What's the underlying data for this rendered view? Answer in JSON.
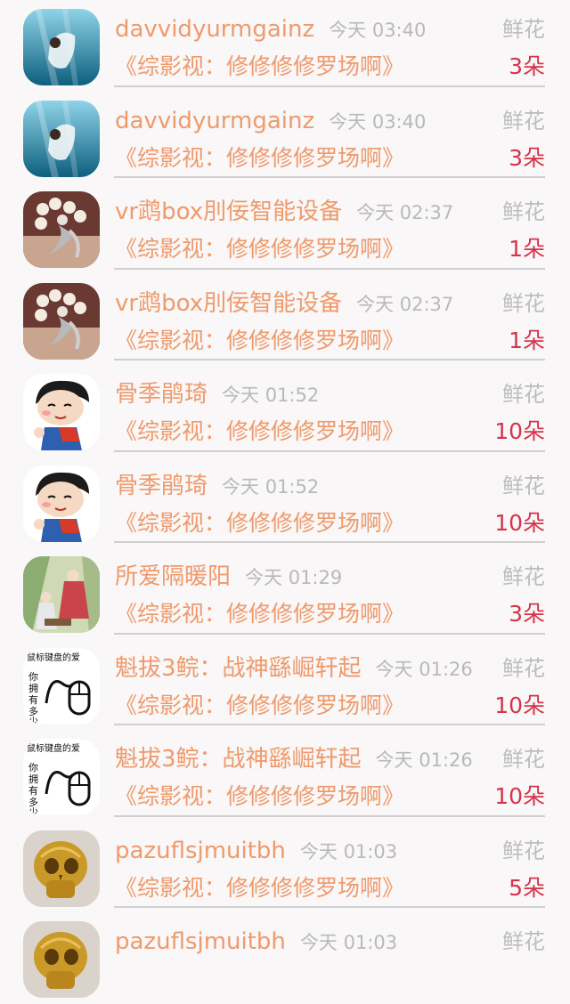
{
  "rows": [
    {
      "name": "davvidyurmgainz",
      "time": "今天 03:40",
      "gift_label": "鲜花",
      "book": "《综影视：修修修修罗场啊》",
      "count": "3朵",
      "avatar": "underwater-girl-avatar"
    },
    {
      "name": "davvidyurmgainz",
      "time": "今天 03:40",
      "gift_label": "鲜花",
      "book": "《综影视：修修修修罗场啊》",
      "count": "3朵",
      "avatar": "underwater-girl-avatar"
    },
    {
      "name": "vr鹉box刖佞智能设备",
      "time": "今天 02:37",
      "gift_label": "鲜花",
      "book": "《综影视：修修修修罗场啊》",
      "count": "1朵",
      "avatar": "pearl-brooch-avatar"
    },
    {
      "name": "vr鹉box刖佞智能设备",
      "time": "今天 02:37",
      "gift_label": "鲜花",
      "book": "《综影视：修修修修罗场啊》",
      "count": "1朵",
      "avatar": "pearl-brooch-avatar"
    },
    {
      "name": "骨季鹃琦",
      "time": "今天 01:52",
      "gift_label": "鲜花",
      "book": "《综影视：修修修修罗场啊》",
      "count": "10朵",
      "avatar": "cartoon-boy-avatar"
    },
    {
      "name": "骨季鹃琦",
      "time": "今天 01:52",
      "gift_label": "鲜花",
      "book": "《综影视：修修修修罗场啊》",
      "count": "10朵",
      "avatar": "cartoon-boy-avatar"
    },
    {
      "name": "所爱隔暖阳",
      "time": "今天 01:29",
      "gift_label": "鲜花",
      "book": "《综影视：修修修修罗场啊》",
      "count": "3朵",
      "avatar": "ancient-painting-avatar"
    },
    {
      "name": "魁拔3鲩：战神繇崛轩起",
      "time": "今天 01:26",
      "gift_label": "鲜花",
      "book": "《综影视：修修修修罗场啊》",
      "count": "10朵",
      "avatar": "mouse-text-avatar",
      "avatar_text": [
        "鼠标键盘的爱",
        "你",
        "拥",
        "有",
        "多",
        "少"
      ]
    },
    {
      "name": "魁拔3鲩：战神繇崛轩起",
      "time": "今天 01:26",
      "gift_label": "鲜花",
      "book": "《综影视：修修修修罗场啊》",
      "count": "10朵",
      "avatar": "mouse-text-avatar",
      "avatar_text": [
        "鼠标键盘的爱",
        "你",
        "拥",
        "有",
        "多",
        "少"
      ]
    },
    {
      "name": "pazuflsjmuitbh",
      "time": "今天 01:03",
      "gift_label": "鲜花",
      "book": "《综影视：修修修修罗场啊》",
      "count": "5朵",
      "avatar": "golden-skull-avatar"
    },
    {
      "name": "pazuflsjmuitbh",
      "time": "今天 01:03",
      "gift_label": "鲜花",
      "book": "",
      "count": "",
      "avatar": "golden-skull-avatar"
    }
  ],
  "colors": {
    "name": "#ef9a6b",
    "count": "#d7334a",
    "time": "#b9b9b9",
    "divider": "#cfcfcf"
  }
}
